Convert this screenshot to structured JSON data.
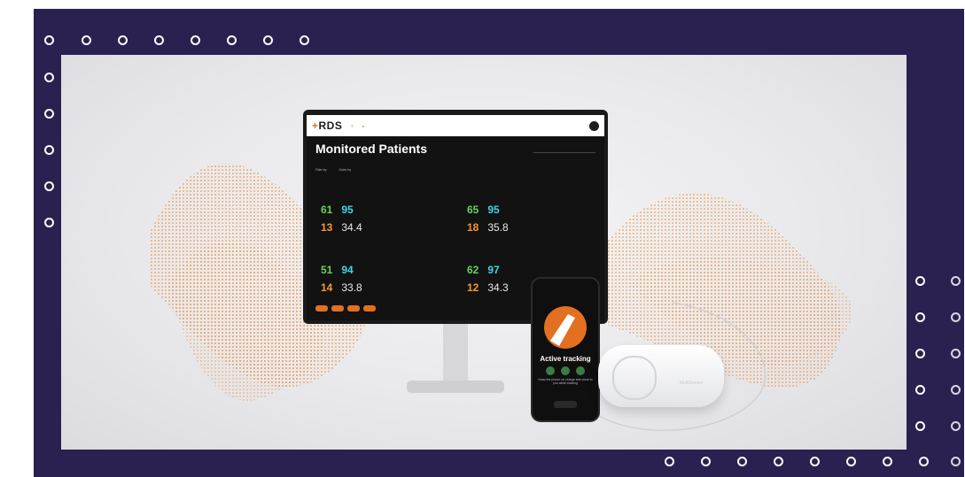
{
  "colors": {
    "frame": "#2a2150",
    "ring": "#ffffff",
    "accent_orange": "#e36f20",
    "vital_green": "#66d35a",
    "vital_cyan": "#3ed6e6",
    "vital_orange": "#f59a2c"
  },
  "monitor": {
    "logo": "RDS",
    "nav": [
      "",
      ""
    ],
    "user": "",
    "breadcrumb": "",
    "title": "Monitored Patients",
    "search_placeholder": "",
    "filters": [
      "Filter by",
      "Order by"
    ],
    "patients": [
      {
        "id": "",
        "v1": "61",
        "v2": "95",
        "v3": "13",
        "v4": "34.4"
      },
      {
        "id": "",
        "v1": "65",
        "v2": "95",
        "v3": "18",
        "v4": "35.8"
      },
      {
        "id": "",
        "v1": "51",
        "v2": "94",
        "v3": "14",
        "v4": "33.8"
      },
      {
        "id": "",
        "v1": "62",
        "v2": "97",
        "v3": "12",
        "v4": "34.3"
      }
    ],
    "pager_text": ""
  },
  "phone": {
    "title": "Active tracking",
    "subtitle": "Keep the phone on charge and close to you while tracking"
  },
  "device": {
    "brand": "MultiSensor"
  }
}
